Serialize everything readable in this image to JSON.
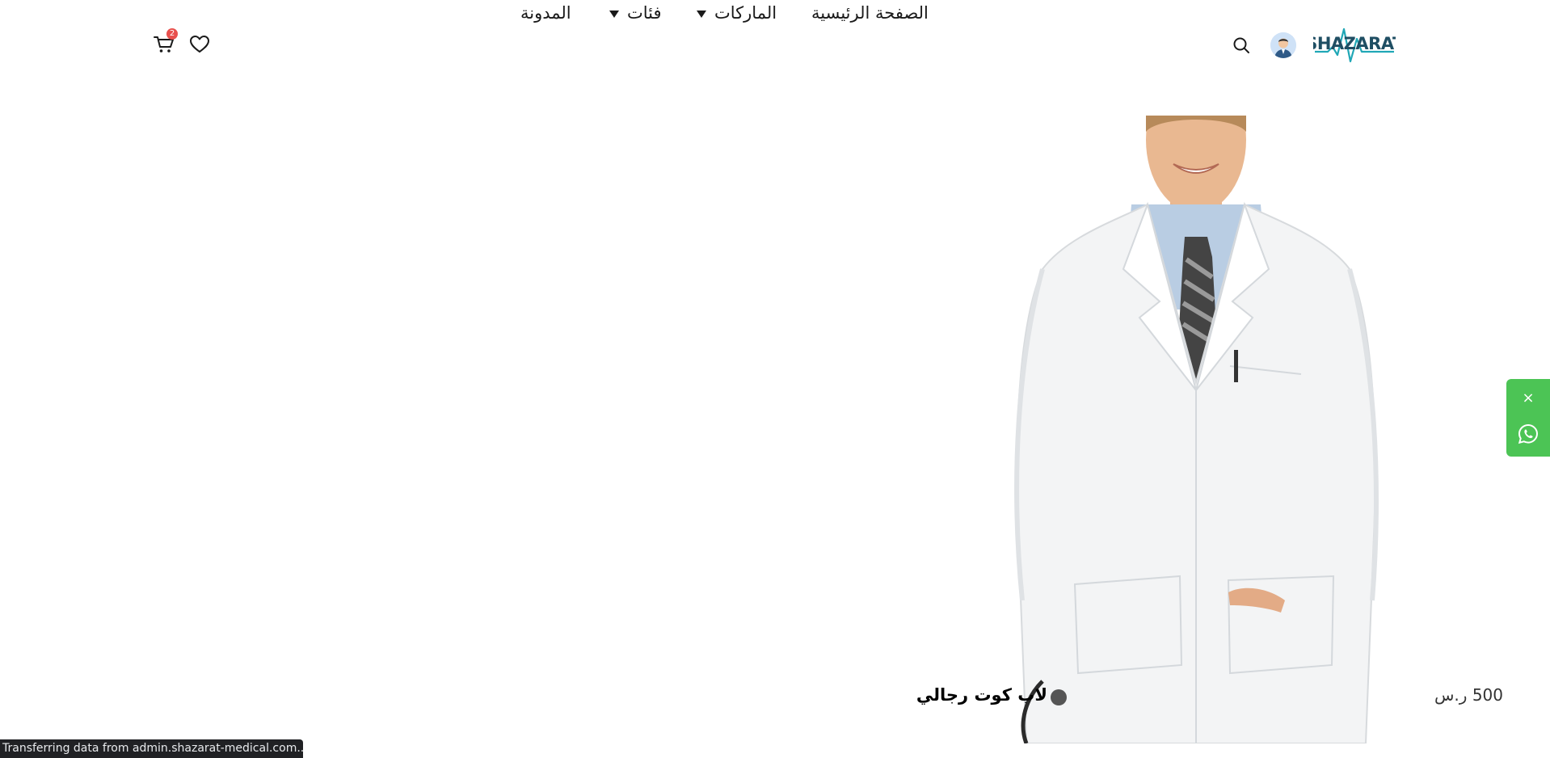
{
  "header": {
    "logo_text": "SHAZARAT",
    "nav": {
      "home": "الصفحة الرئيسية",
      "brands": "الماركات",
      "categories": "فئات",
      "blog": "المدونة"
    },
    "cart_count": "2",
    "icons": {
      "search": "search-icon",
      "wishlist": "heart-icon",
      "cart": "cart-icon",
      "avatar": "user-avatar"
    }
  },
  "product": {
    "name": "لاب كوت رجالي",
    "price": "500 ر.س"
  },
  "whatsapp": {
    "close_label": "×",
    "icon": "whatsapp-icon"
  },
  "status_bar": {
    "text": "Transferring data from admin.shazarat-medical.com..."
  },
  "colors": {
    "accent_green": "#4cc455",
    "badge_red": "#e8504d",
    "logo_dark": "#1f4e63",
    "logo_teal": "#20a7b6"
  }
}
